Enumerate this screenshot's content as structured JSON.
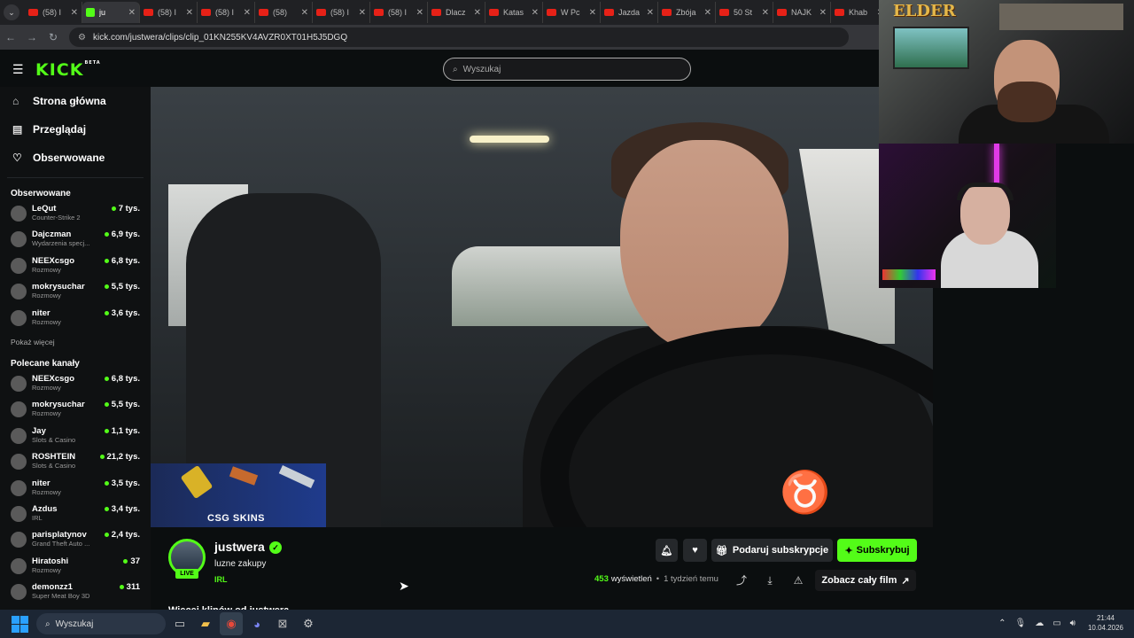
{
  "browser": {
    "tabs": [
      {
        "title": "(58) I",
        "active": false,
        "icon": "youtube-icon"
      },
      {
        "title": "ju",
        "active": true,
        "icon": "kick-icon"
      },
      {
        "title": "(58) I",
        "active": false,
        "icon": "youtube-icon"
      },
      {
        "title": "(58) I",
        "active": false,
        "icon": "youtube-icon"
      },
      {
        "title": "(58)",
        "active": false,
        "icon": "youtube-icon"
      },
      {
        "title": "(58) I",
        "active": false,
        "icon": "youtube-icon"
      },
      {
        "title": "(58) I",
        "active": false,
        "icon": "youtube-icon"
      },
      {
        "title": "Dlacz",
        "active": false,
        "icon": "youtube-icon"
      },
      {
        "title": "Katas",
        "active": false,
        "icon": "youtube-icon"
      },
      {
        "title": "W Pc",
        "active": false,
        "icon": "youtube-icon"
      },
      {
        "title": "Jazda",
        "active": false,
        "icon": "youtube-icon"
      },
      {
        "title": "Zbója",
        "active": false,
        "icon": "youtube-icon"
      },
      {
        "title": "50 St",
        "active": false,
        "icon": "youtube-icon"
      },
      {
        "title": "NAJK",
        "active": false,
        "icon": "youtube-icon"
      },
      {
        "title": "Khab",
        "active": false,
        "icon": "youtube-icon"
      }
    ],
    "url": "kick.com/justwera/clips/clip_01KN255KV4AVZR0XT01H5J5DGQ"
  },
  "kick": {
    "logo": "KICK",
    "logo_badge": "BETA",
    "search_placeholder": "Wyszukaj",
    "nav": [
      {
        "label": "Strona główna",
        "icon": "home-icon"
      },
      {
        "label": "Przeglądaj",
        "icon": "browse-icon"
      },
      {
        "label": "Obserwowane",
        "icon": "heart-icon"
      }
    ],
    "followed_heading": "Obserwowane",
    "followed": [
      {
        "name": "LeQut",
        "category": "Counter-Strike 2",
        "viewers": "7 tys."
      },
      {
        "name": "Dajczman",
        "category": "Wydarzenia specj...",
        "viewers": "6,9 tys."
      },
      {
        "name": "NEEXcsgo",
        "category": "Rozmowy",
        "viewers": "6,8 tys."
      },
      {
        "name": "mokrysuchar",
        "category": "Rozmowy",
        "viewers": "5,5 tys."
      },
      {
        "name": "niter",
        "category": "Rozmowy",
        "viewers": "3,6 tys."
      }
    ],
    "show_more": "Pokaż więcej",
    "recommended_heading": "Polecane kanały",
    "recommended": [
      {
        "name": "NEEXcsgo",
        "category": "Rozmowy",
        "viewers": "6,8 tys."
      },
      {
        "name": "mokrysuchar",
        "category": "Rozmowy",
        "viewers": "5,5 tys."
      },
      {
        "name": "Jay",
        "category": "Slots & Casino",
        "viewers": "1,1 tys."
      },
      {
        "name": "ROSHTEIN",
        "category": "Slots & Casino",
        "viewers": "21,2 tys."
      },
      {
        "name": "niter",
        "category": "Rozmowy",
        "viewers": "3,5 tys."
      },
      {
        "name": "Azdus",
        "category": "IRL",
        "viewers": "3,4 tys."
      },
      {
        "name": "parisplatynov",
        "category": "Grand Theft Auto ...",
        "viewers": "2,4 tys."
      },
      {
        "name": "Hiratoshi",
        "category": "Rozmowy",
        "viewers": "37"
      },
      {
        "name": "demonzz1",
        "category": "Super Meat Boy 3D",
        "viewers": "311"
      }
    ],
    "promo_text": "CSG SKINS",
    "cam_overlay_text": "ELDER",
    "clip": {
      "channel": "justwera",
      "title": "luzne zakupy",
      "category": "IRL",
      "live_badge": "LIVE",
      "views": "453",
      "views_label": "wyświetleń",
      "time_ago": "1 tydzień temu",
      "gift_label": "Podaruj subskrypcje",
      "subscribe_label": "Subskrybuj",
      "full_video_label": "Zobacz cały film",
      "more_clips": "Więcej klipów od justwera"
    }
  },
  "taskbar": {
    "search_placeholder": "Wyszukaj",
    "time": "21:44",
    "date": "10.04.2026"
  },
  "colors": {
    "accent": "#53fc18",
    "bg": "#0b0e0f",
    "sidebar": "#0f1112"
  }
}
